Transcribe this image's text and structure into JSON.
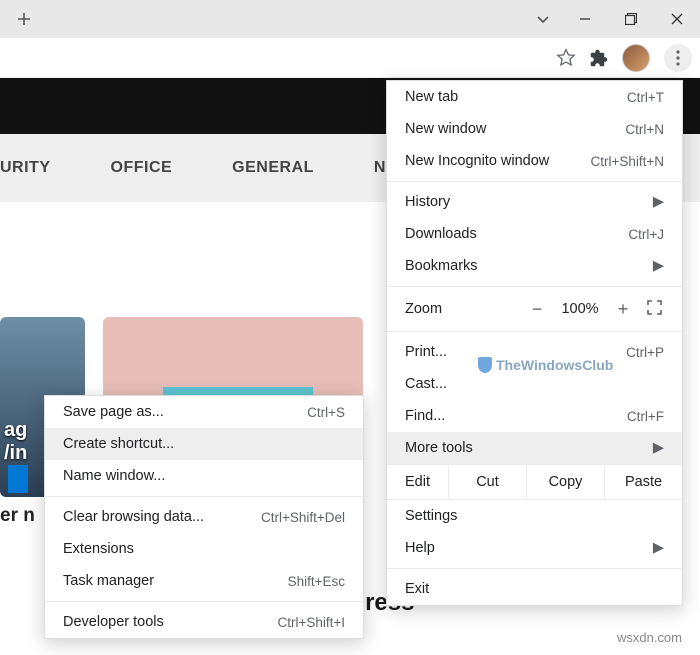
{
  "titlebar": {
    "new_tab_icon": "+"
  },
  "toolbar": {},
  "navbar": {
    "items": [
      "URITY",
      "OFFICE",
      "GENERAL",
      "NEWS"
    ]
  },
  "cards": {
    "card1": {
      "line1": "ag",
      "line2": "/in"
    },
    "subtitle_partial": "er n",
    "headline_partial": "downloading Offline Address"
  },
  "main_menu": {
    "new_tab": {
      "label": "New tab",
      "shortcut": "Ctrl+T"
    },
    "new_window": {
      "label": "New window",
      "shortcut": "Ctrl+N"
    },
    "new_incognito": {
      "label": "New Incognito window",
      "shortcut": "Ctrl+Shift+N"
    },
    "history": {
      "label": "History"
    },
    "downloads": {
      "label": "Downloads",
      "shortcut": "Ctrl+J"
    },
    "bookmarks": {
      "label": "Bookmarks"
    },
    "zoom": {
      "label": "Zoom",
      "value": "100%",
      "minus": "−",
      "plus": "+"
    },
    "print": {
      "label": "Print...",
      "shortcut": "Ctrl+P"
    },
    "cast": {
      "label": "Cast..."
    },
    "find": {
      "label": "Find...",
      "shortcut": "Ctrl+F"
    },
    "more_tools": {
      "label": "More tools"
    },
    "edit": {
      "label": "Edit",
      "cut": "Cut",
      "copy": "Copy",
      "paste": "Paste"
    },
    "settings": {
      "label": "Settings"
    },
    "help": {
      "label": "Help"
    },
    "exit": {
      "label": "Exit"
    }
  },
  "sub_menu": {
    "save_page": {
      "label": "Save page as...",
      "shortcut": "Ctrl+S"
    },
    "create_shortcut": {
      "label": "Create shortcut..."
    },
    "name_window": {
      "label": "Name window..."
    },
    "clear_data": {
      "label": "Clear browsing data...",
      "shortcut": "Ctrl+Shift+Del"
    },
    "extensions": {
      "label": "Extensions"
    },
    "task_manager": {
      "label": "Task manager",
      "shortcut": "Shift+Esc"
    },
    "dev_tools": {
      "label": "Developer tools",
      "shortcut": "Ctrl+Shift+I"
    }
  },
  "branding": {
    "site": "TheWindowsClub",
    "watermark": "wsxdn.com"
  }
}
